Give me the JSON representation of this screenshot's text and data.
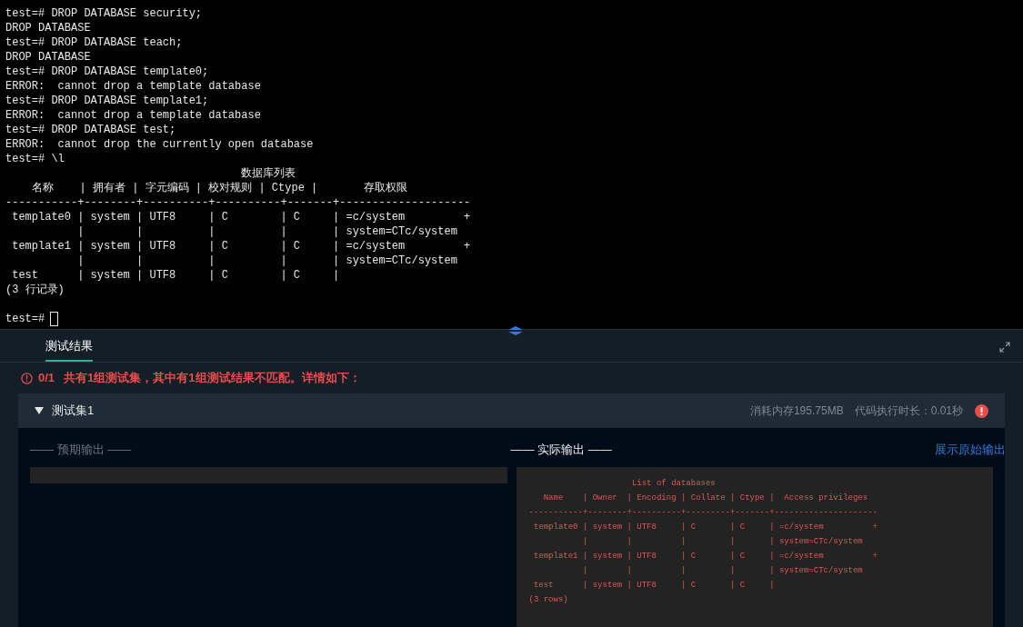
{
  "terminal": {
    "lines": [
      {
        "kind": "text",
        "text": "test=# DROP DATABASE security;"
      },
      {
        "kind": "text",
        "text": "DROP DATABASE"
      },
      {
        "kind": "text",
        "text": "test=# DROP DATABASE teach;"
      },
      {
        "kind": "text",
        "text": "DROP DATABASE"
      },
      {
        "kind": "text",
        "text": "test=# DROP DATABASE template0;"
      },
      {
        "kind": "text",
        "text": "ERROR:  cannot drop a template database"
      },
      {
        "kind": "text",
        "text": "test=# DROP DATABASE template1;"
      },
      {
        "kind": "text",
        "text": "ERROR:  cannot drop a template database"
      },
      {
        "kind": "text",
        "text": "test=# DROP DATABASE test;"
      },
      {
        "kind": "text",
        "text": "ERROR:  cannot drop the currently open database"
      },
      {
        "kind": "text",
        "text": "test=# \\l"
      },
      {
        "kind": "text",
        "text": "                                    数据库列表"
      },
      {
        "kind": "text",
        "text": "    名称    | 拥有者 | 字元编码 | 校对规则 | Ctype |       存取权限"
      },
      {
        "kind": "text",
        "text": "-----------+--------+----------+----------+-------+--------------------"
      },
      {
        "kind": "text",
        "text": " template0 | system | UTF8     | C        | C     | =c/system         +"
      },
      {
        "kind": "text",
        "text": "           |        |          |          |       | system=CTc/system"
      },
      {
        "kind": "text",
        "text": " template1 | system | UTF8     | C        | C     | =c/system         +"
      },
      {
        "kind": "text",
        "text": "           |        |          |          |       | system=CTc/system"
      },
      {
        "kind": "text",
        "text": " test      | system | UTF8     | C        | C     |"
      },
      {
        "kind": "text",
        "text": "(3 行记录)"
      },
      {
        "kind": "blank"
      },
      {
        "kind": "prompt",
        "text": "test=#"
      }
    ]
  },
  "panel": {
    "tabs": [
      {
        "label": "测试结果",
        "selected": true
      }
    ],
    "summary": {
      "score": "0/1",
      "message": "共有1组测试集，其中有1组测试结果不匹配。详情如下："
    },
    "test_set": {
      "title": "测试集1",
      "expanded": true,
      "memory": "消耗内存195.75MB",
      "duration": "代码执行时长：0.01秒"
    },
    "expected": {
      "label": "—— 预期输出 ——"
    },
    "actual": {
      "label": "—— 实际输出 ——",
      "link": "展示原始输出",
      "lines": [
        "                     List of databases",
        "   Name    | Owner  | Encoding | Collate | Ctype |  Access privileges",
        "-----------+--------+----------+---------+-------+---------------------",
        " template0 | system | UTF8     | C       | C     | =c/system          +",
        "           |        |          |         |       | system=CTc/system",
        " template1 | system | UTF8     | C       | C     | =c/system          +",
        "           |        |          |         |       | system=CTc/system",
        " test      | system | UTF8     | C       | C     |",
        "(3 rows)"
      ]
    }
  }
}
